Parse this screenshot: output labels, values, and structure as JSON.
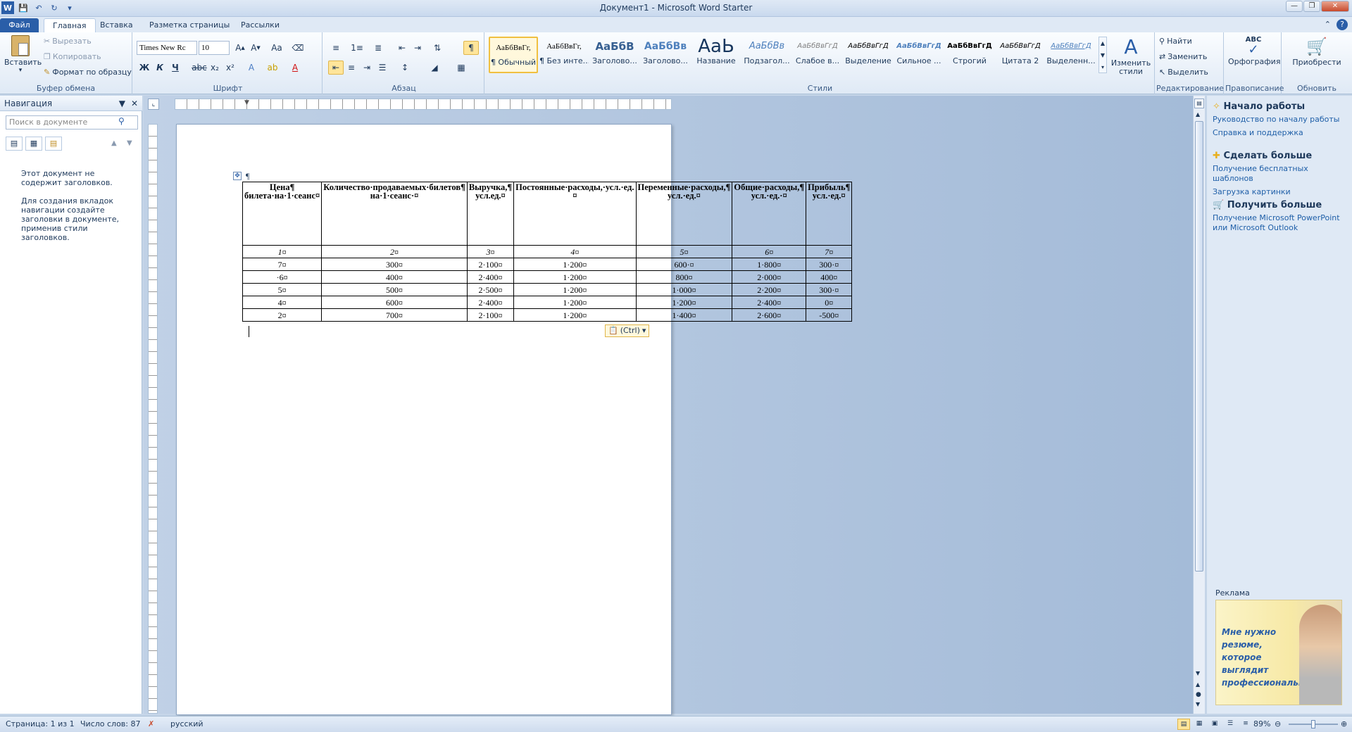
{
  "window": {
    "title": "Документ1  -  Microsoft Word Starter"
  },
  "tabs": [
    {
      "label": "Файл"
    },
    {
      "label": "Главная"
    },
    {
      "label": "Вставка"
    },
    {
      "label": "Разметка страницы"
    },
    {
      "label": "Рассылки"
    }
  ],
  "clipboard": {
    "paste": "Вставить",
    "cut": "Вырезать",
    "copy": "Копировать",
    "format_painter": "Формат по образцу",
    "label": "Буфер обмена"
  },
  "font": {
    "name": "Times New Rc",
    "size": "10",
    "label": "Шрифт"
  },
  "paragraph": {
    "label": "Абзац"
  },
  "styles": {
    "label": "Стили",
    "items": [
      {
        "preview": "АаБбВвГг,",
        "name": "¶ Обычный"
      },
      {
        "preview": "АаБбВвГг,",
        "name": "¶ Без инте..."
      },
      {
        "preview": "АаБбВ",
        "name": "Заголово..."
      },
      {
        "preview": "АаБбВв",
        "name": "Заголово..."
      },
      {
        "preview": "АаЬ",
        "name": "Название"
      },
      {
        "preview": "АаБбВв",
        "name": "Подзагол..."
      },
      {
        "preview": "АаБбВвГгД",
        "name": "Слабое в..."
      },
      {
        "preview": "АаБбВвГгД",
        "name": "Выделение"
      },
      {
        "preview": "АаБбВвГгД",
        "name": "Сильное ..."
      },
      {
        "preview": "АаБбВвГгД",
        "name": "Строгий"
      },
      {
        "preview": "АаБбВвГгД",
        "name": "Цитата 2"
      },
      {
        "preview": "АаБбВвГгД",
        "name": "Выделенн..."
      }
    ],
    "change": "Изменить стили"
  },
  "editing": {
    "find": "Найти",
    "replace": "Заменить",
    "select": "Выделить",
    "label": "Редактирование"
  },
  "proofing": {
    "spell": "Орфография",
    "label": "Правописание"
  },
  "upgrade": {
    "buy": "Приобрести",
    "label": "Обновить"
  },
  "nav": {
    "title": "Навигация",
    "search_placeholder": "Поиск в документе",
    "msg1": "Этот документ не содержит заголовков.",
    "msg2": "Для создания вкладок навигации создайте заголовки в документе, применив стили заголовков."
  },
  "table": {
    "headers": [
      "Цена¶ билета·на·1·сеанс¤",
      "Количество·продаваемых·билетов¶ на·1·сеанс·¤",
      "Выручка,¶ усл.ед.¤",
      "Постоянные·расходы,·усл.·ед.¤",
      "Переменные·расходы,¶ усл.·ед.¤",
      "Общие·расходы,¶ усл.·ед.·¤",
      "Прибыль¶ усл.·ед.¤"
    ],
    "numbers": [
      "1¤",
      "2¤",
      "3¤",
      "4¤",
      "5¤",
      "6¤",
      "7¤"
    ],
    "rows": [
      [
        "7¤",
        "300¤",
        "2·100¤",
        "1·200¤",
        "600·¤",
        "1·800¤",
        "300·¤"
      ],
      [
        "·6¤",
        "400¤",
        "2·400¤",
        "1·200¤",
        "800¤",
        "2·000¤",
        "400¤"
      ],
      [
        "5¤",
        "500¤",
        "2·500¤",
        "1·200¤",
        "1·000¤",
        "2·200¤",
        "300·¤"
      ],
      [
        "4¤",
        "600¤",
        "2·400¤",
        "1·200¤",
        "1·200¤",
        "2·400¤",
        "0¤"
      ],
      [
        "2¤",
        "700¤",
        "2·100¤",
        "1·200¤",
        "1·400¤",
        "2·600¤",
        "-500¤"
      ]
    ],
    "paste_options": "(Ctrl)"
  },
  "right_pane": {
    "start_title": "Начало работы",
    "start_links": [
      "Руководство по началу работы",
      "Справка и поддержка"
    ],
    "more_title": "Сделать больше",
    "more_links": [
      "Получение бесплатных шаблонов",
      "Загрузка картинки"
    ],
    "get_title": "Получить больше",
    "get_link": "Получение Microsoft PowerPoint или Microsoft Outlook",
    "ad_label": "Реклама",
    "ad_text": "Мне нужно резюме, которое выглядит профессионально"
  },
  "status": {
    "page": "Страница: 1 из 1",
    "words": "Число слов: 87",
    "lang": "русский",
    "zoom": "89%"
  },
  "colors": {
    "accent": "#2a5ea8",
    "highlight": "#ffe59a"
  }
}
